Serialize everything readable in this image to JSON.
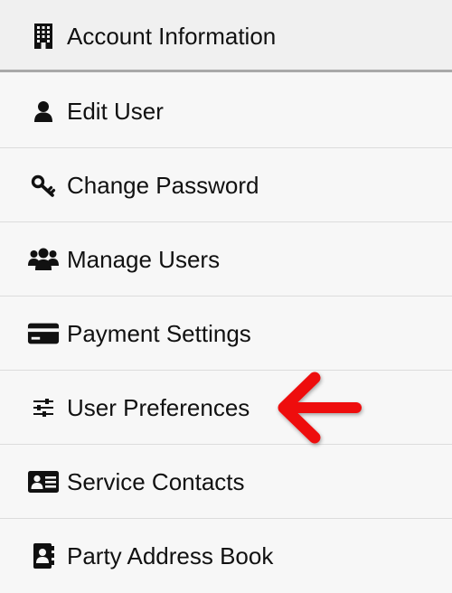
{
  "menu": {
    "header": {
      "label": "Account Information",
      "icon": "building-icon"
    },
    "items": [
      {
        "label": "Edit User",
        "icon": "user-icon"
      },
      {
        "label": "Change Password",
        "icon": "key-icon"
      },
      {
        "label": "Manage Users",
        "icon": "users-icon"
      },
      {
        "label": "Payment Settings",
        "icon": "credit-card-icon"
      },
      {
        "label": "User Preferences",
        "icon": "sliders-icon"
      },
      {
        "label": "Service Contacts",
        "icon": "address-card-icon"
      },
      {
        "label": "Party Address Book",
        "icon": "address-book-icon"
      }
    ]
  },
  "annotation": {
    "icon": "red-arrow-icon",
    "color": "#ee1111",
    "points_to": "User Preferences"
  },
  "colors": {
    "header_bg": "#f0f0f0",
    "item_bg": "#f7f7f7",
    "divider": "#dcdcdc",
    "header_border": "#a9a9a9",
    "text": "#111111"
  }
}
